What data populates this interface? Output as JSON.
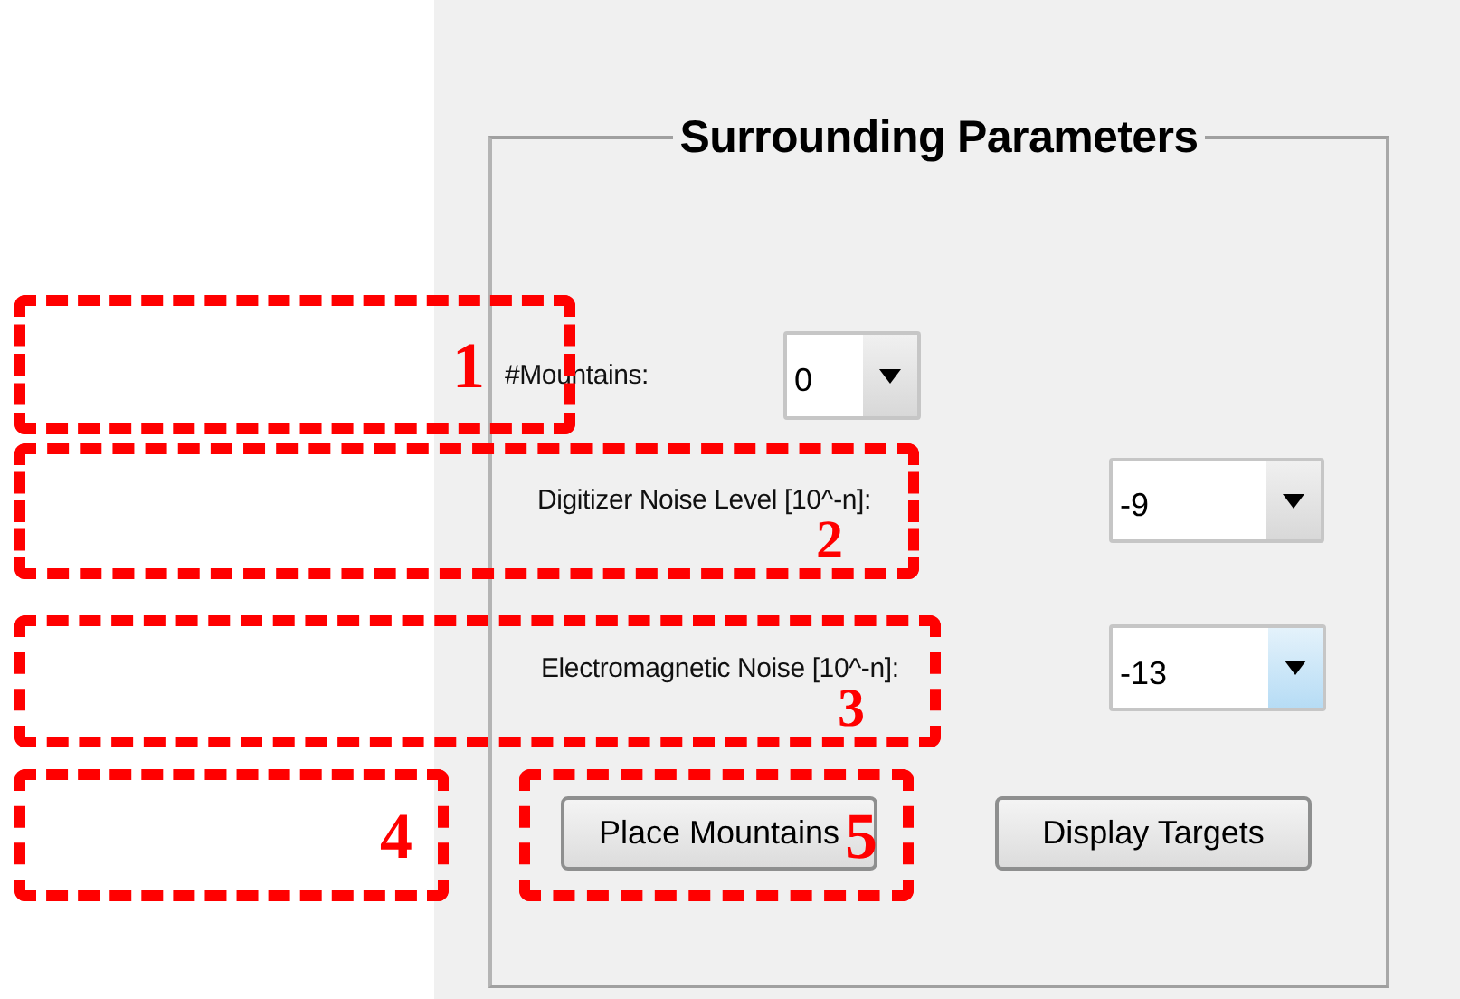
{
  "panel": {
    "title": "Surrounding Parameters",
    "fields": [
      {
        "label": "#Mountains:",
        "value": "0",
        "focused": false
      },
      {
        "label": "Digitizer Noise Level [10^-n]:",
        "value": "-9",
        "focused": false
      },
      {
        "label": "Electromagnetic Noise [10^-n]:",
        "value": "-13",
        "focused": true
      }
    ],
    "buttons": [
      {
        "label": "Place Mountains"
      },
      {
        "label": "Display Targets"
      }
    ]
  },
  "annotations": [
    {
      "label": "1"
    },
    {
      "label": "2"
    },
    {
      "label": "3"
    },
    {
      "label": "4"
    },
    {
      "label": "5"
    }
  ]
}
